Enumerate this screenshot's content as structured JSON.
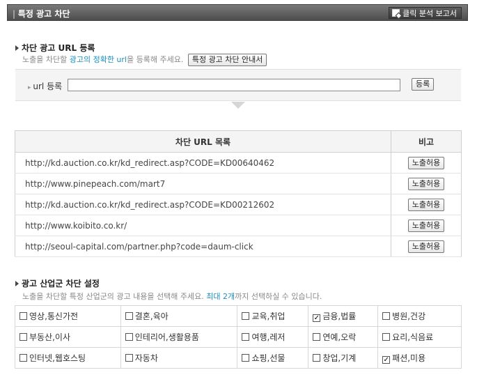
{
  "header": {
    "title": "특정 광고 차단",
    "report_button": "클릭 분석 보고서"
  },
  "url_section": {
    "heading": "차단 광고 URL 등록",
    "desc_prefix": "노출을 차단할 ",
    "desc_highlight": "광고의 정확한 url",
    "desc_suffix": "을 등록해 주세요.",
    "guide_button": "특정 광고 차단 안내서",
    "url_label": "url 등록",
    "url_value": "",
    "register_button": "등록"
  },
  "url_table": {
    "col_url": "차단 URL 목록",
    "col_note": "비고",
    "rows": [
      {
        "url": "http://kd.auction.co.kr/kd_redirect.asp?CODE=KD00640462",
        "action": "노출허용"
      },
      {
        "url": "http://www.pinepeach.com/mart7",
        "action": "노출허용"
      },
      {
        "url": "http://kd.auction.co.kr/kd_redirect.asp?CODE=KD00212602",
        "action": "노출허용"
      },
      {
        "url": "http://www.koibito.co.kr/",
        "action": "노출허용"
      },
      {
        "url": "http://seoul-capital.com/partner.php?code=daum-click",
        "action": "노출허용"
      }
    ]
  },
  "category_section": {
    "heading": "광고 산업군 차단 설정",
    "desc_prefix": "노출을 차단할 특정 산업군의 광고 내용을 선택해 주세요. ",
    "desc_highlight": "최대 2개",
    "desc_suffix": "까지 선택하실 수 있습니다.",
    "rows": [
      [
        {
          "label": "영상,통신가전",
          "checked": false
        },
        {
          "label": "결혼,육아",
          "checked": false
        },
        {
          "label": "교육,취업",
          "checked": false
        },
        {
          "label": "금융,법률",
          "checked": true
        },
        {
          "label": "병원,건강",
          "checked": false
        }
      ],
      [
        {
          "label": "부동산,이사",
          "checked": false
        },
        {
          "label": "인테리어,생활용품",
          "checked": false
        },
        {
          "label": "여행,레저",
          "checked": false
        },
        {
          "label": "연예,오락",
          "checked": false
        },
        {
          "label": "요리,식음료",
          "checked": false
        }
      ],
      [
        {
          "label": "인터넷,웹호스팅",
          "checked": false
        },
        {
          "label": "자동차",
          "checked": false
        },
        {
          "label": "쇼핑,선물",
          "checked": false
        },
        {
          "label": "창업,기계",
          "checked": false
        },
        {
          "label": "패션,미용",
          "checked": true
        }
      ]
    ]
  },
  "colors": {
    "highlight": "#1a8fbf",
    "titlebar": "#555555"
  }
}
